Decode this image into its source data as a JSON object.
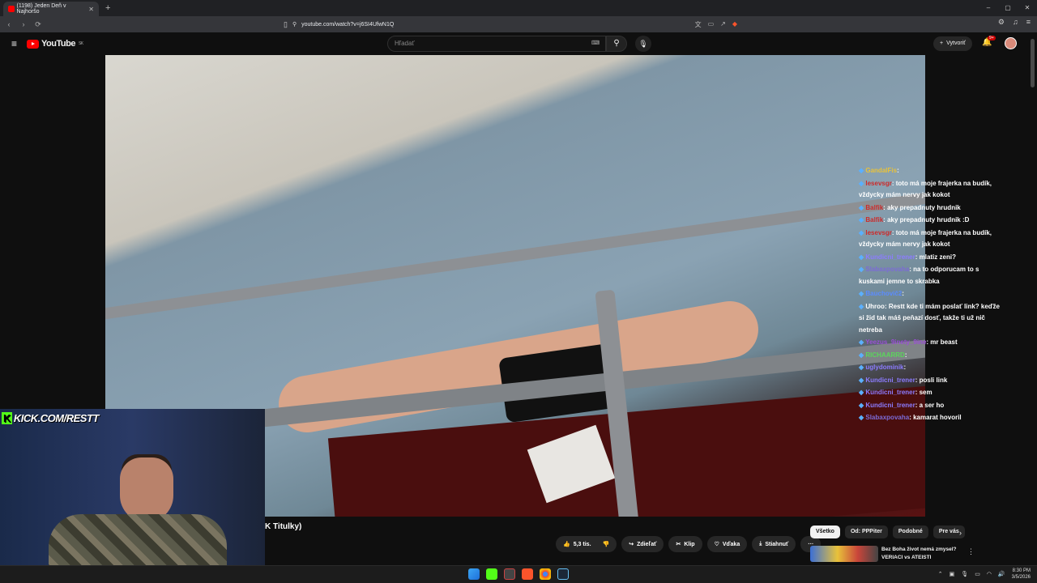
{
  "browser": {
    "tab_title": "(1198) Jeden Deň v Najhoršo",
    "new_tab": "+",
    "url": "youtube.com/watch?v=j6SI4UfwN1Q",
    "window_controls": [
      "–",
      "▢",
      "✕"
    ]
  },
  "youtube": {
    "logo": "YouTube",
    "region": "SK",
    "search_placeholder": "Hľadať",
    "create_label": "Vytvoriť",
    "notif_badge": "9+"
  },
  "chat": [
    {
      "user": "GandalFis",
      "text": "",
      "color": "#e8c23a"
    },
    {
      "user": "lesevsgr",
      "text": "toto má moje frajerka na budík, vždycky mám nervy jak kokot",
      "color": "#cc2b2b"
    },
    {
      "user": "Balfik",
      "text": "aky prepadnuty hrudnik",
      "color": "#cc2b2b"
    },
    {
      "user": "Balfik",
      "text": "aky prepadnuty hrudnik :D",
      "color": "#cc2b2b"
    },
    {
      "user": "lesevsgr",
      "text": "toto má moje frajerka na budík, vždycky mám nervy jak kokot",
      "color": "#cc2b2b"
    },
    {
      "user": "Kundicni_trener",
      "text": "mlatiz zeni?",
      "color": "#8c7cff"
    },
    {
      "user": "Slabaxpovaha",
      "text": "na to odporucam to s kuskami jemne to skrabka",
      "color": "#7c6bd6"
    },
    {
      "user": "Bauchovič2",
      "text": "",
      "color": "#5b8cff"
    },
    {
      "user": "Uhroo",
      "text": "Restt kde ti mám poslať link? keďže si žid tak máš peňazí dosť, takže ti už nič netreba",
      "color": "#ffffff"
    },
    {
      "user": "Yeezus_9inety_9ine",
      "text": "mr beast",
      "color": "#9b4fd6"
    },
    {
      "user": "RICHAARRD",
      "text": "",
      "color": "#5bd65b"
    },
    {
      "user": "uglydominik",
      "text": "",
      "color": "#8c7cff"
    },
    {
      "user": "Kundicni_trener",
      "text": "posli link",
      "color": "#8c7cff"
    },
    {
      "user": "Kundicni_trener",
      "text": "sem",
      "color": "#8c7cff"
    },
    {
      "user": "Kundicni_trener",
      "text": "a ser ho",
      "color": "#8c7cff"
    },
    {
      "user": "Slabaxpovaha",
      "text": "kamarat hovoril",
      "color": "#7c6bd6"
    }
  ],
  "overlay": {
    "kick_text": "KICK.COM/RESTT",
    "kick_k": "K"
  },
  "video_title_fragment": "K Titulky)",
  "actions": {
    "like_count": "5,3 tis.",
    "share": "Zdieľať",
    "clip": "Klip",
    "thanks": "Vďaka",
    "download": "Stiahnuť",
    "more": "···"
  },
  "filters": [
    "Všetko",
    "Od: PPPiter",
    "Podobné",
    "Pre vás"
  ],
  "recommendation": {
    "title_line1": "Bez Boha život nemá zmysel?",
    "title_line2": "VERIACI vs ATEISTI"
  },
  "clock": {
    "time": "8:30 PM",
    "date": "3/5/2026"
  }
}
